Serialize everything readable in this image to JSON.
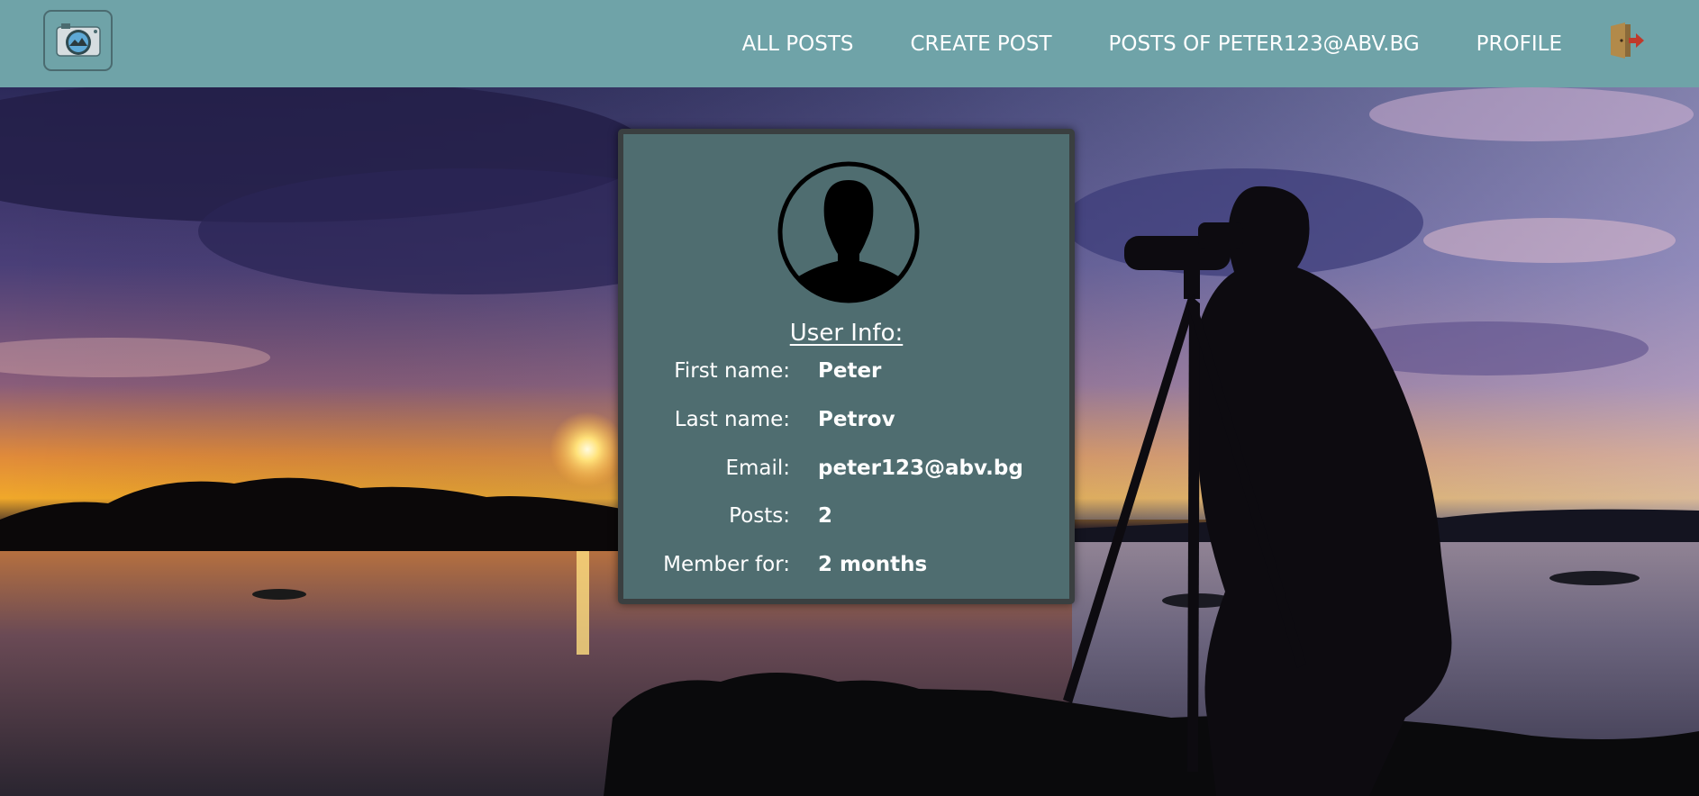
{
  "header": {
    "nav": [
      {
        "label": "ALL POSTS"
      },
      {
        "label": "CREATE POST"
      },
      {
        "label": "POSTS OF PETER123@ABV.BG"
      },
      {
        "label": "PROFILE"
      }
    ],
    "logo_icon": "camera-icon",
    "logout_icon": "door-exit-icon"
  },
  "card": {
    "title": "User Info:",
    "avatar_icon": "user-silhouette-icon",
    "rows": [
      {
        "label": "First name:",
        "value": "Peter"
      },
      {
        "label": "Last name:",
        "value": "Petrov"
      },
      {
        "label": "Email:",
        "value": "peter123@abv.bg"
      },
      {
        "label": "Posts:",
        "value": "2"
      },
      {
        "label": "Member for:",
        "value": "2 months"
      }
    ]
  },
  "colors": {
    "header_bg": "#6fa3a8",
    "card_bg": "#4f6d70",
    "card_border": "#3a3f40",
    "text": "#ffffff"
  }
}
